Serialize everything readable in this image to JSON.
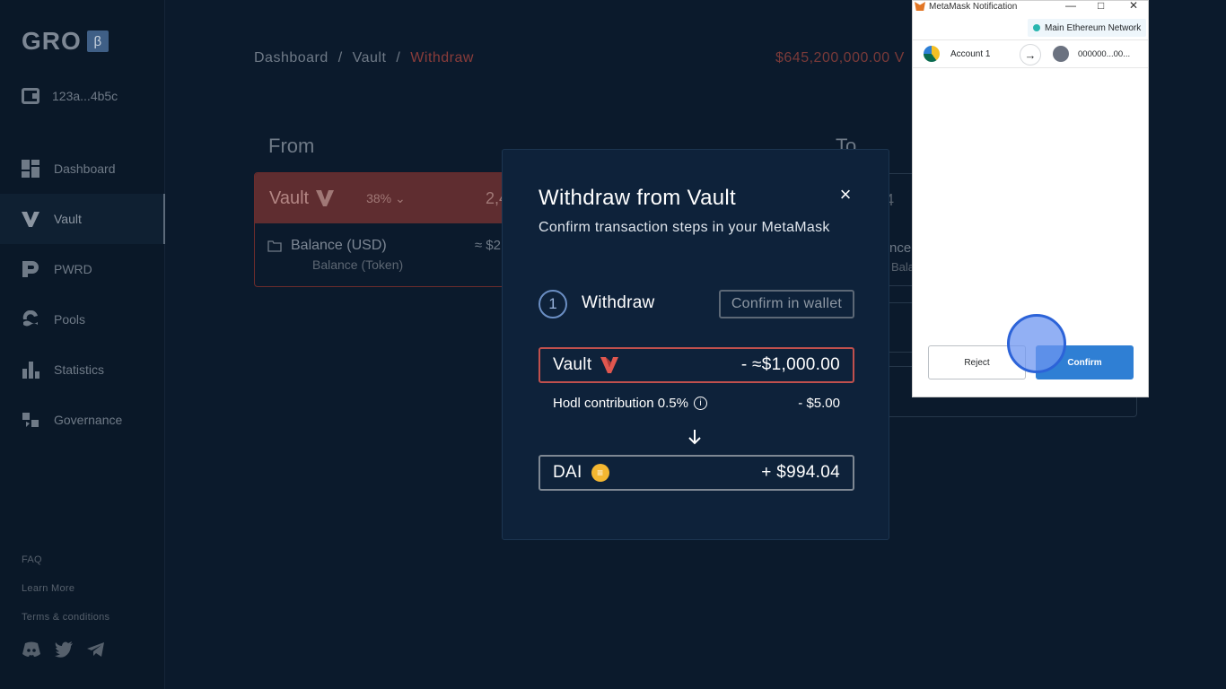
{
  "app": {
    "logo": "GRO",
    "beta": "β",
    "wallet_address": "123a...4b5c"
  },
  "sidebar": {
    "items": [
      {
        "label": "Dashboard",
        "icon": "dashboard-icon"
      },
      {
        "label": "Vault",
        "icon": "vault-icon",
        "active": true
      },
      {
        "label": "PWRD",
        "icon": "pwrd-icon"
      },
      {
        "label": "Pools",
        "icon": "pools-icon"
      },
      {
        "label": "Statistics",
        "icon": "statistics-icon"
      },
      {
        "label": "Governance",
        "icon": "governance-icon"
      }
    ],
    "footer": [
      "FAQ",
      "Learn More",
      "Terms & conditions"
    ],
    "socials": [
      "discord-icon",
      "twitter-icon",
      "telegram-icon"
    ]
  },
  "header": {
    "breadcrumb": [
      "Dashboard",
      "Vault",
      "Withdraw"
    ],
    "separator": "/",
    "tvl": "$645,200,000.00 V"
  },
  "background": {
    "from_label": "From",
    "to_label": "To",
    "from_token": "Vault",
    "from_pct": "38%",
    "from_amount": "2,4",
    "balance_usd": "Balance (USD)",
    "balance_token": "Balance (Token)",
    "approx": "≈ $2",
    "to_num": "4",
    "to_bal": "nce",
    "to_bal2": "Bala"
  },
  "modal": {
    "title": "Withdraw from Vault",
    "subtitle": "Confirm transaction steps in your MetaMask",
    "close": "×",
    "step_number": "1",
    "step_label": "Withdraw",
    "step_button": "Confirm in wallet",
    "from_token": "Vault",
    "from_amount": "- ≈$1,000.00",
    "hodl_label": "Hodl contribution 0.5%",
    "hodl_info": "i",
    "hodl_value": "- $5.00",
    "to_token": "DAI",
    "to_amount": "+ $994.04"
  },
  "metamask": {
    "title": "MetaMask Notification",
    "network": "Main Ethereum Network",
    "account": "Account 1",
    "destination": "000000...00...",
    "reject": "Reject",
    "confirm": "Confirm"
  },
  "colors": {
    "accent_red": "#c0504d",
    "metamask_blue": "#2f7fd4",
    "dai_gold": "#f4b731"
  }
}
